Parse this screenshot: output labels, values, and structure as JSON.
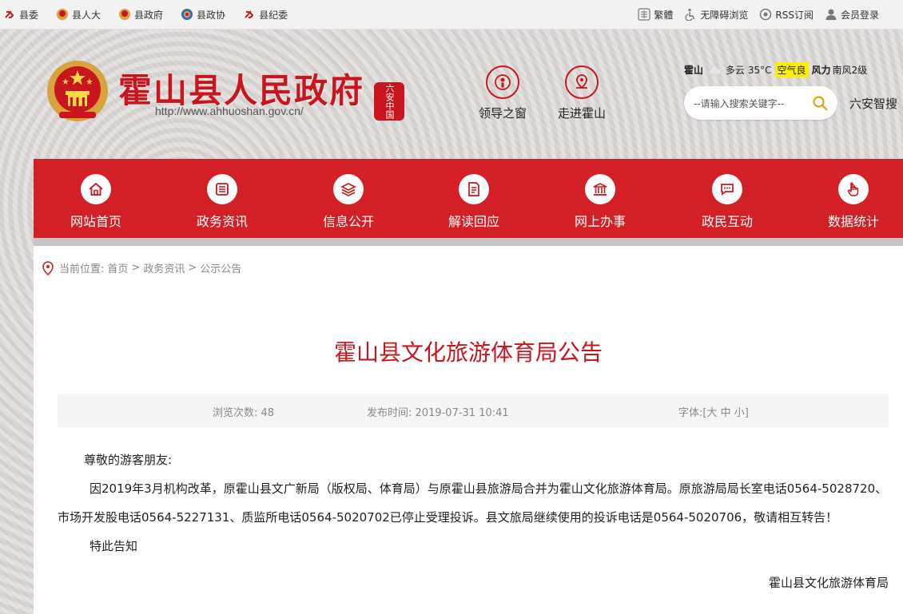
{
  "topbar": {
    "left_links": [
      "县委",
      "县人大",
      "县政府",
      "县政协",
      "县纪委"
    ],
    "right_links": [
      "繁體",
      "无障碍浏览",
      "RSS订阅",
      "会员登录"
    ]
  },
  "header": {
    "title": "霍山县人民政府",
    "url": "http://www.ahhuoshan.gov.cn/",
    "seal_text": "六安中国",
    "quick_links": [
      "领导之窗",
      "走进霍山"
    ]
  },
  "weather": {
    "city": "霍山",
    "condition": "多云",
    "temp": "35°C",
    "aqi": "空气良",
    "wind_label": "风力",
    "wind": "南风2级"
  },
  "search": {
    "placeholder": "--请输入搜索关键字--",
    "extra": "六安智搜"
  },
  "nav": [
    "网站首页",
    "政务资讯",
    "信息公开",
    "解读回应",
    "网上办事",
    "政民互动",
    "数据统计"
  ],
  "breadcrumb": {
    "label": "当前位置:",
    "items": [
      "首页",
      ">",
      "政务资讯",
      ">",
      "公示公告"
    ]
  },
  "article": {
    "title": "霍山县文化旅游体育局公告",
    "views_label": "浏览次数:",
    "views": "48",
    "date_label": "发布时间:",
    "date": "2019-07-31 10:41",
    "font_label": "字体:[",
    "font_large": "大",
    "font_medium": "中",
    "font_small": "小",
    "font_close": "]",
    "greeting": "尊敬的游客朋友:",
    "paragraph": "因2019年3月机构改革，原霍山县文广新局（版权局、体育局）与原霍山县旅游局合并为霍山文化旅游体育局。原旅游局局长室电话0564-5028720、市场开发股电话0564-5227131、质监所电话0564-5020702已停止受理投诉。县文旅局继续使用的投诉电话是0564-5020706，敬请相互转告！",
    "closing": "特此告知",
    "signature": "霍山县文化旅游体育局"
  },
  "colors": {
    "brand_red": "#d31f26",
    "title_red": "#c9151e",
    "aqi_yellow": "#ffee00"
  }
}
